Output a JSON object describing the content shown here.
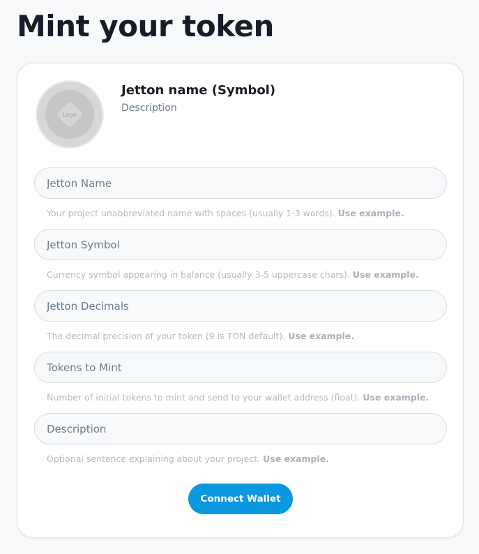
{
  "page": {
    "title": "Mint your token"
  },
  "token_preview": {
    "logo_text": "Logo",
    "name": "Jetton name (Symbol)",
    "description": "Description"
  },
  "fields": [
    {
      "placeholder": "Jetton Name",
      "value": "",
      "help": "Your project unabbreviated name with spaces (usually 1-3 words).",
      "help_link": "Use example."
    },
    {
      "placeholder": "Jetton Symbol",
      "value": "",
      "help": "Currency symbol appearing in balance (usually 3-5 uppercase chars).",
      "help_link": "Use example."
    },
    {
      "placeholder": "Jetton Decimals",
      "value": "",
      "help": "The decimal precision of your token (9 is TON default).",
      "help_link": "Use example."
    },
    {
      "placeholder": "Tokens to Mint",
      "value": "",
      "help": "Number of initial tokens to mint and send to your wallet address (float).",
      "help_link": "Use example."
    },
    {
      "placeholder": "Description",
      "value": "",
      "help": "Optional sentence explaining about your project.",
      "help_link": "Use example."
    }
  ],
  "actions": {
    "connect_wallet_label": "Connect Wallet"
  },
  "colors": {
    "accent": "#0a98e0",
    "background": "#f7f9fb",
    "card": "#ffffff",
    "title": "#161c28",
    "help_text": "#b2bac2"
  }
}
